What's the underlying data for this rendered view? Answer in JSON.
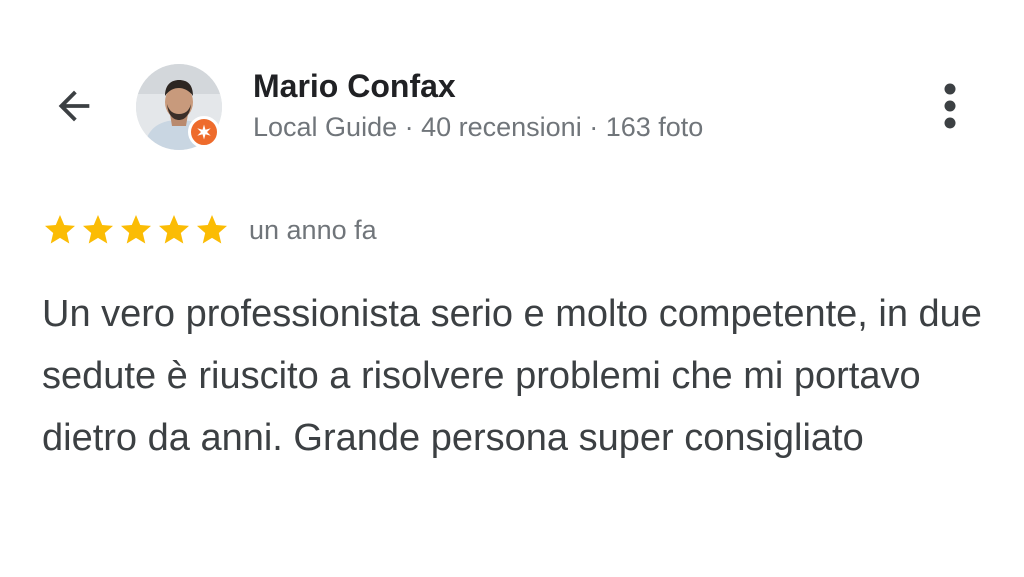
{
  "reviewer": {
    "name": "Mario Confax",
    "meta": "Local Guide · 40 recensioni · 163 foto",
    "badge_icon": "local-guide-star-badge",
    "badge_color": "#ee6b2c"
  },
  "review": {
    "rating": 5,
    "rating_max": 5,
    "star_color": "#fbbc04",
    "time": "un anno fa",
    "text": "Un vero professionista serio e molto competente, in due sedute è riuscito a risolvere problemi che mi portavo dietro da anni. Grande persona super consigliato"
  },
  "icons": {
    "back": "arrow-back-icon",
    "more": "more-vert-icon"
  }
}
